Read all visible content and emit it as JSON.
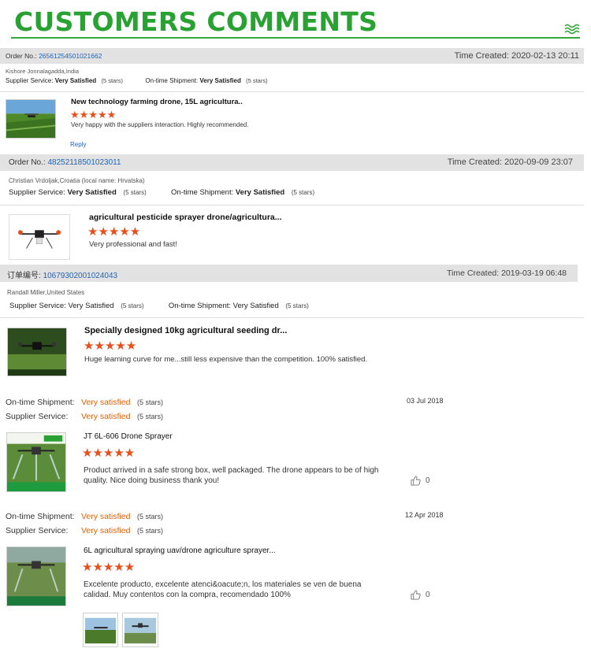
{
  "header": {
    "title": "CUSTOMERS COMMENTS"
  },
  "reviews": [
    {
      "order_label": "Order No.:",
      "order_no": "26561254501021662",
      "time_label": "Time Created:",
      "time": "2020-02-13 20:11",
      "customer": "Kishore Jonnalagadda,India",
      "supplier_label": "Supplier Service:",
      "supplier_value": "Very Satisfied",
      "supplier_stars": "(5 stars)",
      "shipment_label": "On-time Shipment:",
      "shipment_value": "Very Satisfied",
      "shipment_stars": "(5 stars)",
      "product": "New technology farming drone, 15L agricultura..",
      "rating": "★★★★★",
      "comment": "Very happy with the suppliers interaction. Highly recommended.",
      "reply": "Reply"
    },
    {
      "order_label": "Order No.:",
      "order_no": "48252118501023011",
      "time_label": "Time Created:",
      "time": "2020-09-09 23:07",
      "customer": "Christian Vrdoljak,Croatia (local name: Hrvatska)",
      "supplier_label": "Supplier Service:",
      "supplier_value": "Very Satisfied",
      "supplier_stars": "(5 stars)",
      "shipment_label": "On-time Shipment:",
      "shipment_value": "Very Satisfied",
      "shipment_stars": "(5 stars)",
      "product": "agricultural pesticide sprayer drone/agricultura...",
      "rating": "★★★★★",
      "comment": "Very professional and fast!"
    },
    {
      "order_label": "订单编号:",
      "order_no": "10679302001024043",
      "time_label": "Time Created:",
      "time": "2019-03-19 06:48",
      "customer": "Randall Miller,United States",
      "supplier_label": "Supplier Service:",
      "supplier_value": "Very Satisfied",
      "supplier_stars": "(5 stars)",
      "shipment_label": "On-time Shipment:",
      "shipment_value": "Very Satisfied",
      "shipment_stars": "(5 stars)",
      "product": "Specially designed 10kg agricultural seeding dr...",
      "rating": "★★★★★",
      "comment": "Huge learning curve for me...still less expensive than the competition.  100% satisfied."
    }
  ],
  "feedback": [
    {
      "shipment_label": "On-time Shipment:",
      "shipment_value": "Very satisfied",
      "shipment_stars": "(5 stars)",
      "supplier_label": "Supplier Service:",
      "supplier_value": "Very satisfied",
      "supplier_stars": "(5 stars)",
      "date": "03 Jul 2018",
      "product": "JT 6L-606 Drone Sprayer",
      "rating": "★★★★★",
      "comment": "Product arrived in a safe strong box, well packaged. The drone appears to be of high quality. Nice doing business thank you!",
      "likes": "0"
    },
    {
      "shipment_label": "On-time Shipment:",
      "shipment_value": "Very satisfied",
      "shipment_stars": "(5 stars)",
      "supplier_label": "Supplier Service:",
      "supplier_value": "Very satisfied",
      "supplier_stars": "(5 stars)",
      "date": "12 Apr 2018",
      "product": "6L agricultural spraying uav/drone agriculture sprayer...",
      "rating": "★★★★★",
      "comment": "Excelente producto, excelente atenci&oacute;n, los materiales se ven de buena calidad. Muy contentos con la compra, recomendado 100%",
      "likes": "0"
    }
  ],
  "colors": {
    "brand_green": "#2aa233",
    "star_orange": "#e84e1b",
    "link_blue": "#2463b4",
    "value_orange": "#e0620d"
  }
}
